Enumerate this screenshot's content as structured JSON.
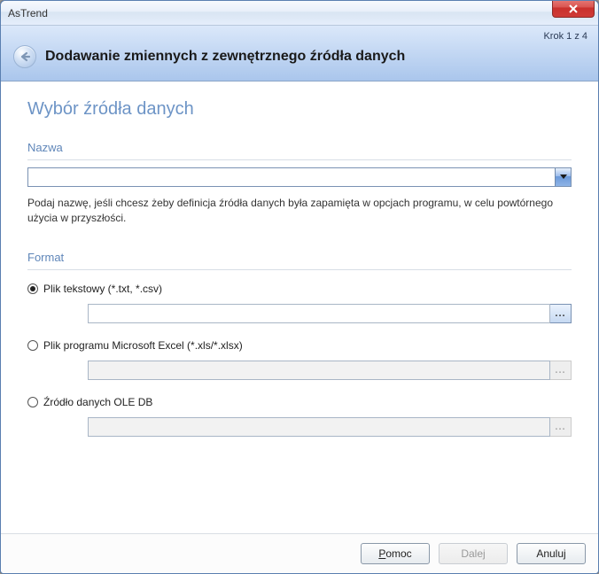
{
  "window": {
    "title": "AsTrend"
  },
  "wizard": {
    "step_indicator": "Krok 1 z 4",
    "title": "Dodawanie zmiennych z zewnętrznego źródła danych"
  },
  "page": {
    "heading": "Wybór źródła danych",
    "name_section": {
      "label": "Nazwa",
      "value": "",
      "help": "Podaj nazwę, jeśli chcesz żeby definicja źródła danych była zapamięta w opcjach programu, w celu powtórnego użycia w przyszłości."
    },
    "format_section": {
      "label": "Format",
      "options": [
        {
          "label": "Plik tekstowy (*.txt, *.csv)",
          "checked": true,
          "path": "",
          "enabled": true
        },
        {
          "label": "Plik programu Microsoft Excel (*.xls/*.xlsx)",
          "checked": false,
          "path": "",
          "enabled": false
        },
        {
          "label": "Źródło danych OLE DB",
          "checked": false,
          "path": "",
          "enabled": false
        }
      ]
    }
  },
  "footer": {
    "help_first": "P",
    "help_rest": "omoc",
    "next": "Dalej",
    "cancel": "Anuluj"
  },
  "browse_glyph": "..."
}
